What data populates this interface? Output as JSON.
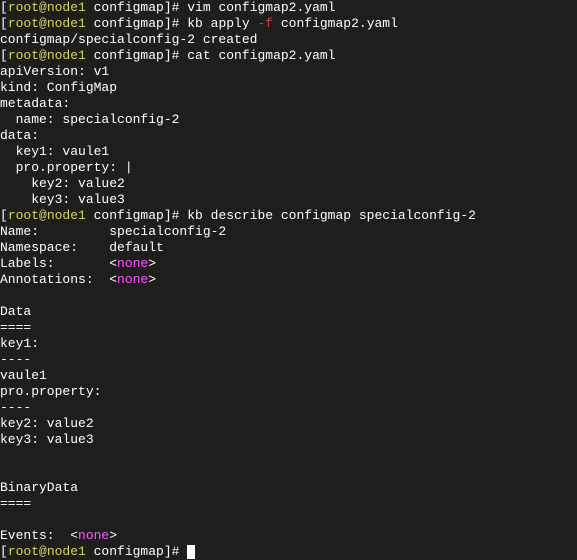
{
  "line1": {
    "prompt_open": "[",
    "user": "root@node1",
    "dir": " configmap",
    "prompt_close": "]# ",
    "cmd": "vim configmap2.yaml"
  },
  "line2": {
    "prompt_open": "[",
    "user": "root@node1",
    "dir": " configmap",
    "prompt_close": "]# ",
    "cmd_a": "kb apply ",
    "flag": "-f",
    "cmd_b": " configmap2.yaml"
  },
  "line3": "configmap/specialconfig-2 created",
  "line4": {
    "prompt_open": "[",
    "user": "root@node1",
    "dir": " configmap",
    "prompt_close": "]# ",
    "cmd": "cat configmap2.yaml"
  },
  "yaml": {
    "l1": "apiVersion: v1",
    "l2": "kind: ConfigMap",
    "l3": "metadata:",
    "l4": "  name: specialconfig-2",
    "l5": "data:",
    "l6": "  key1: vaule1",
    "l7": "  pro.property: |",
    "l8": "    key2: value2",
    "l9": "    key3: value3"
  },
  "line5": {
    "prompt_open": "[",
    "user": "root@node1",
    "dir": " configmap",
    "prompt_close": "]# ",
    "cmd": "kb describe configmap specialconfig-2"
  },
  "describe": {
    "name_label": "Name:         ",
    "name_val": "specialconfig-2",
    "ns_label": "Namespace:    ",
    "ns_val": "default",
    "labels_label": "Labels:       <",
    "none": "none",
    "labels_end": ">",
    "anno_label": "Annotations:  <",
    "anno_end": ">",
    "data_header": "Data",
    "equals": "====",
    "key1": "key1:",
    "dashes": "----",
    "val1": "vaule1",
    "proprop": "pro.property:",
    "key2": "key2: value2",
    "key3": "key3: value3",
    "binary_header": "BinaryData",
    "events_label": "Events:  <",
    "events_end": ">"
  },
  "last": {
    "prompt_open": "[",
    "user": "root@node1",
    "dir": " configmap",
    "prompt_close": "]# "
  }
}
